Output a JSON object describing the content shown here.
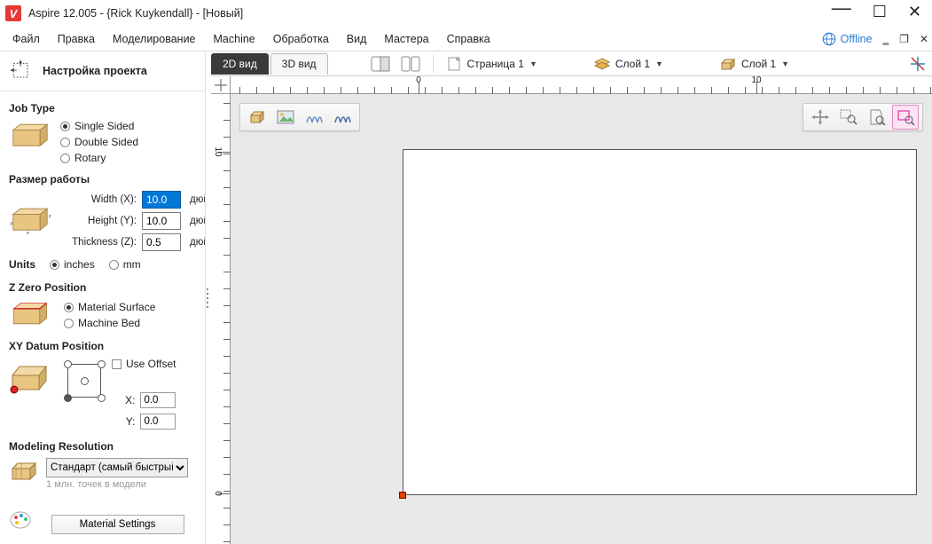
{
  "titlebar": {
    "app": "Aspire 12.005",
    "user": "{Rick Kuykendall}",
    "doc": "[Новый]"
  },
  "menu": {
    "items": [
      "Файл",
      "Правка",
      "Моделирование",
      "Machine",
      "Обработка",
      "Вид",
      "Мастера",
      "Справка"
    ],
    "offline": "Offline"
  },
  "panel": {
    "title": "Настройка проекта",
    "jobtype": {
      "title": "Job Type",
      "single": "Single Sided",
      "double": "Double Sided",
      "rotary": "Rotary"
    },
    "size": {
      "title": "Размер работы",
      "w_lbl": "Width (X):",
      "h_lbl": "Height (Y):",
      "t_lbl": "Thickness (Z):",
      "w": "10.0",
      "h": "10.0",
      "t": "0.5",
      "unit": "дюйм"
    },
    "units": {
      "title": "Units",
      "inches": "inches",
      "mm": "mm"
    },
    "zzero": {
      "title": "Z Zero Position",
      "surf": "Material Surface",
      "bed": "Machine Bed"
    },
    "xy": {
      "title": "XY Datum Position",
      "offset": "Use Offset",
      "xl": "X:",
      "yl": "Y:",
      "x": "0.0",
      "y": "0.0"
    },
    "model": {
      "title": "Modeling Resolution",
      "sel": "Стандарт (самый быстрый)",
      "hint": "1 млн. точек в модели"
    },
    "matbtn": "Material Settings"
  },
  "tabs": {
    "v2d": "2D вид",
    "v3d": "3D вид"
  },
  "toolbar": {
    "page": "Страница 1",
    "layer_a": "Слой 1",
    "layer_b": "Слой 1"
  },
  "ruler": {
    "majors": [
      {
        "p": 212,
        "l": "0"
      },
      {
        "p": 593,
        "l": "10"
      }
    ]
  }
}
